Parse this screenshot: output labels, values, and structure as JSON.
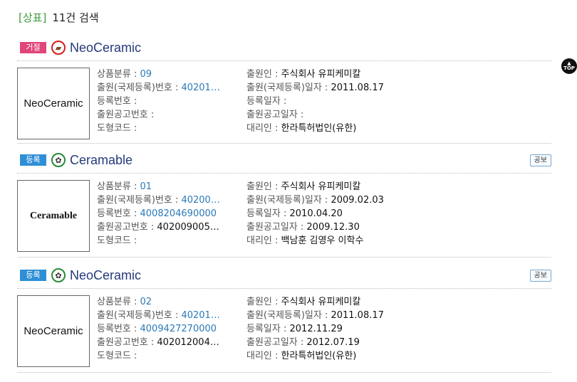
{
  "header": {
    "tag": "[상표]",
    "count": "11건 검색"
  },
  "top_button": {
    "label": "TOP",
    "arrow": "▲"
  },
  "records": [
    {
      "badge": "거절",
      "status": "reject",
      "title": "NeoCeramic",
      "thumb_text": "NeoCeramic",
      "pub_label": "",
      "left": [
        {
          "label": "상품분류 : ",
          "value": "09",
          "link": true
        },
        {
          "label": "출원(국제등록)번호 : ",
          "value": "40201…",
          "link": true
        },
        {
          "label": "등록번호 : ",
          "value": "",
          "link": false
        },
        {
          "label": "출원공고번호 : ",
          "value": "",
          "link": false
        },
        {
          "label": "도형코드 : ",
          "value": "",
          "link": false
        }
      ],
      "right": [
        {
          "label": "출원인 : ",
          "value": "주식회사 유피케미칼"
        },
        {
          "label": "출원(국제등록)일자 : ",
          "value": "2011.08.17"
        },
        {
          "label": "등록일자 : ",
          "value": ""
        },
        {
          "label": "출원공고일자 : ",
          "value": ""
        },
        {
          "label": "대리인 : ",
          "value": "한라특허법인(유한)"
        }
      ]
    },
    {
      "badge": "등록",
      "status": "reg",
      "title": "Ceramable",
      "thumb_text": "Ceramable",
      "pub_label": "공보",
      "left": [
        {
          "label": "상품분류 : ",
          "value": "01",
          "link": true
        },
        {
          "label": "출원(국제등록)번호 : ",
          "value": "40200…",
          "link": true
        },
        {
          "label": "등록번호 : ",
          "value": "4008204690000",
          "link": true
        },
        {
          "label": "출원공고번호 : ",
          "value": "402009005…",
          "link": false
        },
        {
          "label": "도형코드 : ",
          "value": "",
          "link": false
        }
      ],
      "right": [
        {
          "label": "출원인 : ",
          "value": "주식회사 유피케미칼"
        },
        {
          "label": "출원(국제등록)일자 : ",
          "value": "2009.02.03"
        },
        {
          "label": "등록일자 : ",
          "value": "2010.04.20"
        },
        {
          "label": "출원공고일자 : ",
          "value": "2009.12.30"
        },
        {
          "label": "대리인 : ",
          "value": "백남훈 김영우 이학수"
        }
      ]
    },
    {
      "badge": "등록",
      "status": "reg",
      "title": "NeoCeramic",
      "thumb_text": "NeoCeramic",
      "pub_label": "공보",
      "left": [
        {
          "label": "상품분류 : ",
          "value": "02",
          "link": true
        },
        {
          "label": "출원(국제등록)번호 : ",
          "value": "40201…",
          "link": true
        },
        {
          "label": "등록번호 : ",
          "value": "4009427270000",
          "link": true
        },
        {
          "label": "출원공고번호 : ",
          "value": "402012004…",
          "link": false
        },
        {
          "label": "도형코드 : ",
          "value": "",
          "link": false
        }
      ],
      "right": [
        {
          "label": "출원인 : ",
          "value": "주식회사 유피케미칼"
        },
        {
          "label": "출원(국제등록)일자 : ",
          "value": "2011.08.17"
        },
        {
          "label": "등록일자 : ",
          "value": "2012.11.29"
        },
        {
          "label": "출원공고일자 : ",
          "value": "2012.07.19"
        },
        {
          "label": "대리인 : ",
          "value": "한라특허법인(유한)"
        }
      ]
    }
  ]
}
